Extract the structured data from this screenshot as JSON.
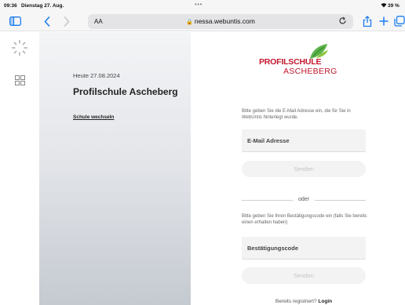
{
  "status_bar": {
    "time": "09:36",
    "date": "Dienstag 27. Aug.",
    "battery": "39 %"
  },
  "browser": {
    "reader_label": "AA",
    "url": "nessa.webuntis.com",
    "icons": [
      "sidebar-icon",
      "back-icon",
      "forward-icon",
      "reload-icon",
      "share-icon",
      "new-tab-icon",
      "tabs-icon"
    ],
    "accent_color": "#1a7cf0"
  },
  "left_panel": {
    "today": "Heute 27.08.2024",
    "school_name": "Profilschule Ascheberg",
    "change_school": "Schule wechseln"
  },
  "logo": {
    "line1": "PROFILSCHULE",
    "line2": "ASCHEBERG",
    "brand_color": "#c2172d"
  },
  "form": {
    "email_hint": "Bitte geben Sie die E-Mail Adresse ein, die für Sie in WebUntis hinterlegt wurde.",
    "email_placeholder": "E-Mail Adresse",
    "send_label": "Senden",
    "or_label": "oder",
    "code_hint": "Bitte geben Sie Ihren Bestätigungscode ein (falls Sie bereits einen erhalten haben)",
    "code_placeholder": "Bestätigungscode",
    "send_label_2": "Senden",
    "registered_text": "Bereits registriert?",
    "login_label": "Login"
  }
}
